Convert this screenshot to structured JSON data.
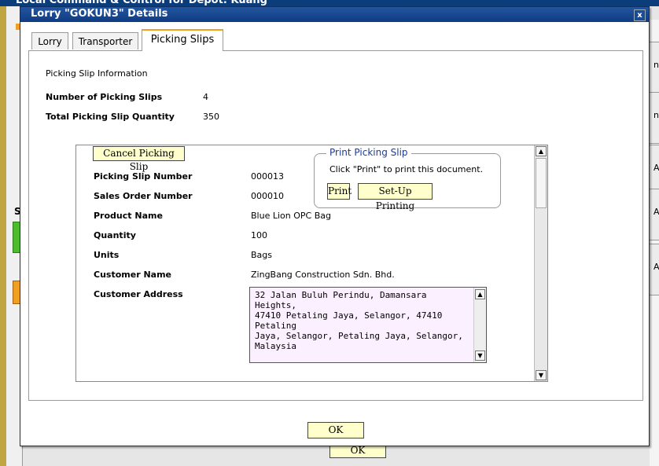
{
  "background": {
    "window_title": "Local Command & Control for Depot: Kuang",
    "side_label": "S",
    "right_cells": [
      "n",
      "n",
      "A",
      "A",
      "A"
    ],
    "ok_label": "OK"
  },
  "dialog": {
    "title": "Lorry \"GOKUN3\" Details",
    "close_label": "x",
    "tabs": [
      "Lorry",
      "Transporter",
      "Picking Slips"
    ],
    "active_tab": "Picking Slips"
  },
  "info": {
    "section_title": "Picking Slip Information",
    "num_label": "Number of Picking Slips",
    "num_value": "4",
    "total_label": "Total Picking Slip Quantity",
    "total_value": "350"
  },
  "slip": {
    "cancel_button": "Cancel Picking Slip",
    "fields": [
      {
        "label": "Picking Slip Number",
        "value": "000013"
      },
      {
        "label": "Sales Order Number",
        "value": "000010"
      },
      {
        "label": "Product Name",
        "value": "Blue Lion OPC Bag"
      },
      {
        "label": "Quantity",
        "value": "100"
      },
      {
        "label": "Units",
        "value": "Bags"
      },
      {
        "label": "Customer Name",
        "value": "ZingBang Construction Sdn. Bhd."
      }
    ],
    "address_label": "Customer Address",
    "address_value": "32 Jalan Buluh Perindu, Damansara Heights,\n47410 Petaling Jaya, Selangor, 47410 Petaling\nJaya, Selangor, Petaling Jaya, Selangor,\nMalaysia"
  },
  "print_box": {
    "legend": "Print Picking Slip",
    "instruction": "Click \"Print\" to print this document.",
    "print_button": "Print",
    "setup_button": "Set-Up Printing"
  },
  "footer": {
    "ok_button": "OK"
  },
  "colors": {
    "titlebar": "#0f3c84",
    "active_tab_accent": "#f0a020",
    "button_bg": "#ffffcc",
    "address_bg": "#fbf0ff",
    "legend_text": "#1a3c9a"
  }
}
